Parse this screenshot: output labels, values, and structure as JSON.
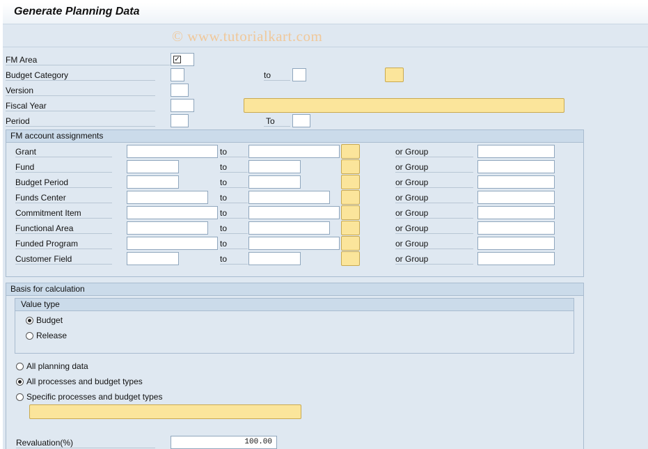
{
  "title": "Generate Planning Data",
  "watermark": "© www.tutorialkart.com",
  "fields": {
    "fm_area": "FM Area",
    "budget_category": "Budget Category",
    "version": "Version",
    "fiscal_year": "Fiscal Year",
    "period": "Period",
    "to_lower": "to",
    "to_upper": "To"
  },
  "fm_assign": {
    "header": "FM account assignments",
    "to": "to",
    "or_group": "or Group",
    "rows": [
      "Grant",
      "Fund",
      "Budget Period",
      "Funds Center",
      "Commitment Item",
      "Functional Area",
      "Funded Program",
      "Customer Field"
    ]
  },
  "basis": {
    "header": "Basis for calculation",
    "value_type": {
      "header": "Value type",
      "options": [
        "Budget",
        "Release"
      ],
      "selected": "Budget"
    },
    "scope_options": [
      "All planning data",
      "All processes and budget types",
      "Specific processes and budget types"
    ],
    "scope_selected": "All processes and budget types",
    "revaluation_label": "Revaluation(%)",
    "revaluation_value": "100.00"
  }
}
